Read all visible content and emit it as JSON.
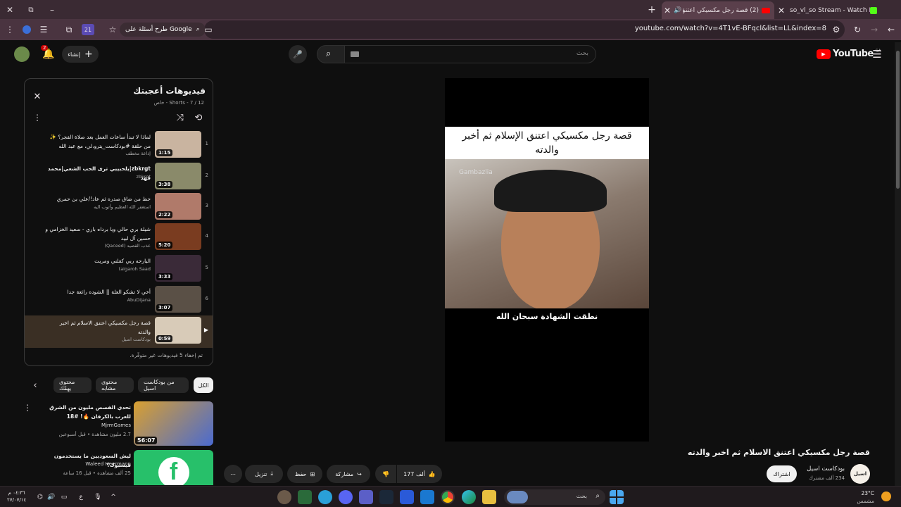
{
  "browser": {
    "tabs": [
      {
        "title": "so_vl_so Stream - Watch Live o"
      },
      {
        "title": "(2) قصة رجل مكسيكي اعتنق"
      }
    ],
    "url": "youtube.com/watch?v=4T1vE-BFqcl&list=LL&index=8",
    "google_lens_label": "طرح أسئلة على Google",
    "extension_badge": "21"
  },
  "youtube": {
    "logo": "YouTube",
    "region": "SA",
    "search_placeholder": "بحث",
    "create_label": "إنشاء",
    "notif_count": "2"
  },
  "playlist": {
    "title": "فيديوهات أعجبتك",
    "subtitle": "خاص - Shorts - 7 / 12",
    "hidden_note": "تم إخفاء 5 فيديوهات غير متوفّرة.",
    "items": [
      {
        "index": "1",
        "title": "لماذا لا تبدأ ساعات العمل بعد صلاة الفجر؟ ✨ من حلقة #بودكاست_يترو،لي، مع عبد الله عقيد…",
        "channel": "إذاعة مخطف",
        "duration": "1:15",
        "thumb": "#c9b4a0"
      },
      {
        "index": "2",
        "title": "zbkrgt|يلحبيبي ترى الحب الشعي|محمد فهد",
        "channel": "zbkrgt",
        "duration": "3:38",
        "thumb": "#8a8a6a"
      },
      {
        "index": "3",
        "title": "حظ من ضاق صدره ثم عاد!/علي بن حمري",
        "channel": "استغفر الله العظيم وأتوب اليه",
        "duration": "2:22",
        "thumb": "#b07a6a"
      },
      {
        "index": "4",
        "title": "شيلة بري حالي ويا برداه باري - سعيد الخزامي و حسين آل لبيد",
        "channel": "عذب القصيد (Qaceed)",
        "duration": "5:20",
        "thumb": "#7a3c20"
      },
      {
        "index": "5",
        "title": "البارحه ربي كفلني ومريت",
        "channel": "taigaroh Saad",
        "duration": "3:33",
        "thumb": "#3a2a38"
      },
      {
        "index": "6",
        "title": "أخي لا تشكو العلة || الشوده رائعة جدا",
        "channel": "AbuDijana",
        "duration": "3:07",
        "thumb": "#5a5046"
      },
      {
        "index": "▶",
        "title": "قصة رجل مكسيكي اعتنق الاسلام ثم اخبر والدته",
        "channel": "بودكاست اسيل",
        "duration": "0:59",
        "thumb": "#d8cbb8"
      }
    ]
  },
  "chips": [
    "الكل",
    "من بودكاست اسيل",
    "محتوى مشابه",
    "محتوى يهمّك"
  ],
  "recommendations": [
    {
      "title": "تحدي الفصص مليون من الشرق للعرب بالكرفان 🔥! #18",
      "channel": "MjrmGames",
      "meta": "2.7 مليون مشاهدة • قبل أسبوعين",
      "duration": "56:07"
    },
    {
      "title": "ليش السعوديين ما يستخدمون فيسبوك؟",
      "channel": "Waleed Heermann",
      "meta": "25 ألف مشاهدة • قبل 16 ساعة",
      "duration": ""
    }
  ],
  "video": {
    "caption_top": "قصة رجل مكسيكي اعتنق الإسلام ثم أخبر والدته",
    "watermark": "Gambazlia",
    "caption_bottom": "نطقت الشهادة سبحان الله",
    "title": "قصة رجل مكسيكي اعتنق الاسلام ثم اخبر والدته",
    "channel": "بودكاست اسيل",
    "subscribers": "234 ألف مشترك",
    "subscribe_label": "اشتراك",
    "likes": "177 ألف",
    "share_label": "مشاركة",
    "save_label": "حفظ",
    "download_label": "تنزيل",
    "channel_avatar_text": "اسيل"
  },
  "taskbar": {
    "search_placeholder": "بحث",
    "weather_temp": "23°C",
    "weather_desc": "مشمس",
    "time": "٠٤:٣٦ م",
    "date": "٢٧/٠٧/١٤",
    "lang": "ع"
  },
  "colors": {
    "accent_red": "#ff0000",
    "bg": "#0f0f0f",
    "surface": "#272727"
  }
}
